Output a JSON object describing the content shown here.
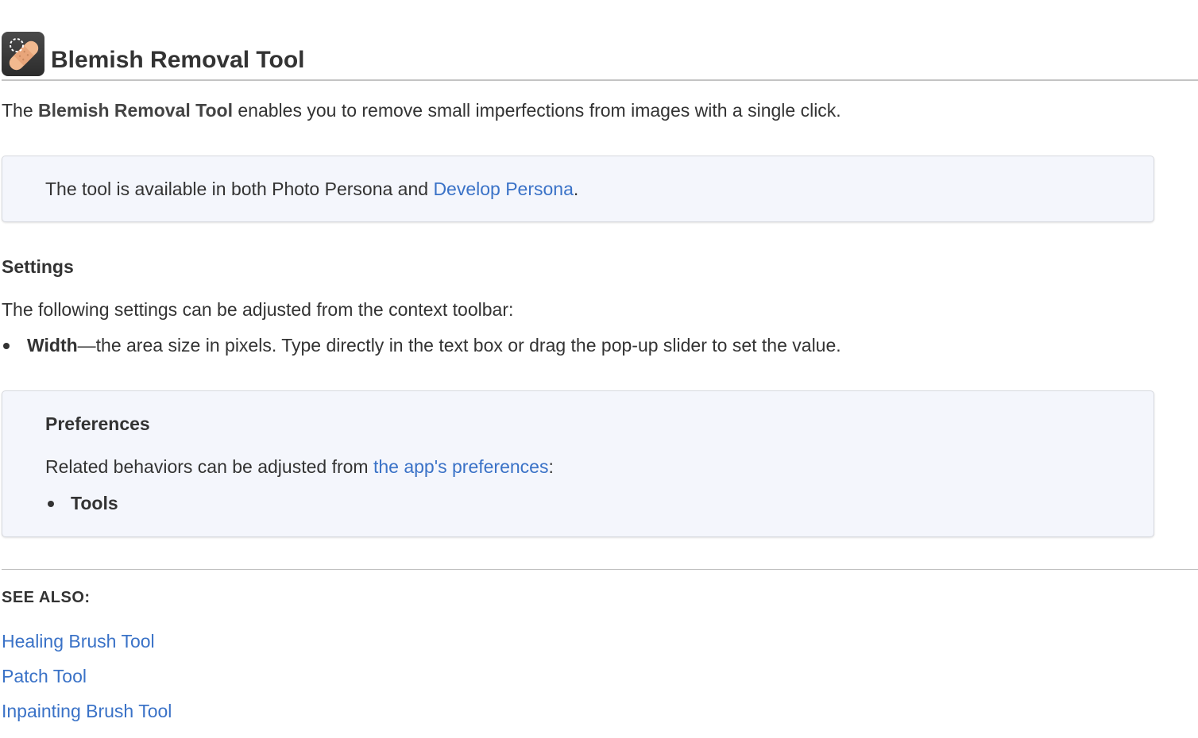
{
  "header": {
    "icon": "blemish-bandage-icon",
    "title": "Blemish Removal Tool"
  },
  "intro": {
    "prefix": "The ",
    "tool_name": "Blemish Removal Tool",
    "suffix": " enables you to remove small imperfections from images with a single click."
  },
  "note": {
    "text": "The tool is available in both Photo Persona and ",
    "link_label": "Develop Persona",
    "end": "."
  },
  "settings": {
    "heading": "Settings",
    "description": "The following settings can be adjusted from the context toolbar:",
    "items": [
      {
        "term": "Width",
        "description": "—the area size in pixels. Type directly in the text box or drag the pop-up slider to set the value."
      }
    ]
  },
  "preferences": {
    "heading": "Preferences",
    "text": "Related behaviors can be adjusted from ",
    "link_label": "the app's preferences",
    "end": ":",
    "items": [
      "Tools"
    ]
  },
  "see_also": {
    "heading": "SEE ALSO:",
    "links": [
      "Healing Brush Tool",
      "Patch Tool",
      "Inpainting Brush Tool"
    ]
  },
  "colors": {
    "link": "#3a72c7",
    "text": "#333333",
    "note_background": "#f4f6fc",
    "icon_background": "#3a3a3a",
    "bandage": "#f2b98f"
  }
}
